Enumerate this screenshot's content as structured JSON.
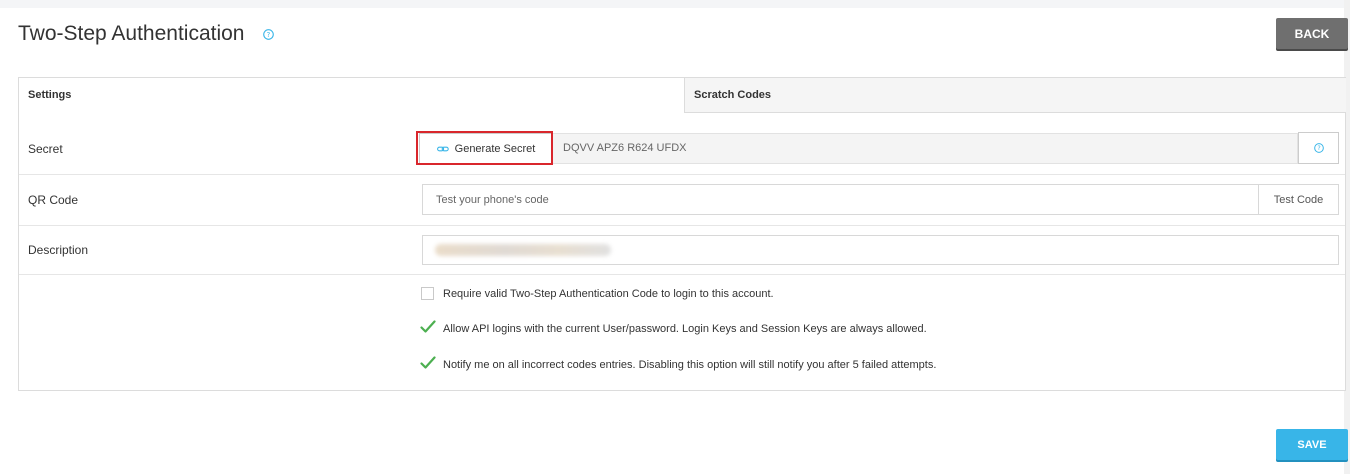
{
  "header": {
    "title": "Two-Step Authentication",
    "help_icon": "question-circle-icon",
    "back_label": "BACK"
  },
  "tabs": [
    {
      "label": "Settings",
      "active": true
    },
    {
      "label": "Scratch Codes",
      "active": false
    }
  ],
  "form": {
    "secret": {
      "label": "Secret",
      "generate_label": "Generate Secret",
      "generate_icon": "link-icon",
      "value": "DQVV APZ6 R624 UFDX",
      "help_icon": "question-circle-icon"
    },
    "qr_code": {
      "label": "QR Code",
      "placeholder": "Test your phone's code",
      "test_label": "Test Code"
    },
    "description": {
      "label": "Description",
      "value": ""
    },
    "options": [
      {
        "label": "Require valid Two-Step Authentication Code to login to this account.",
        "checked": false
      },
      {
        "label": "Allow API logins with the current User/password. Login Keys and Session Keys are always allowed.",
        "checked": true
      },
      {
        "label": "Notify me on all incorrect codes entries. Disabling this option will still notify you after 5 failed attempts.",
        "checked": true
      }
    ]
  },
  "footer": {
    "save_label": "SAVE"
  },
  "colors": {
    "accent": "#38b5e8",
    "back_button": "#6f6f6f",
    "check": "#4caf50",
    "highlight": "#d9262c"
  }
}
